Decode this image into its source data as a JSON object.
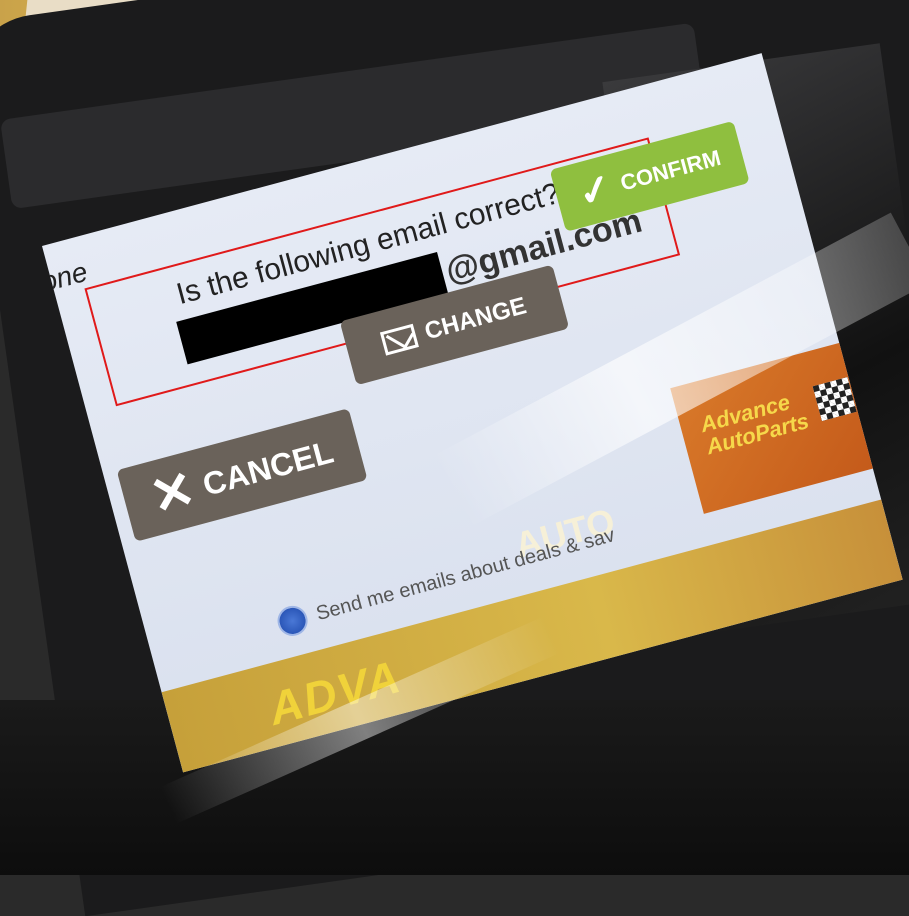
{
  "screen": {
    "brand_fragment": "one",
    "question": "Is the following email correct?",
    "email_domain": "@gmail.com",
    "buttons": {
      "confirm": "CONFIRM",
      "change": "CHANGE",
      "cancel": "CANCEL"
    },
    "optin_label": "Send me emails about deals & sav",
    "footer_text": "ADVA",
    "footer_auto": "AUTO",
    "logo_text_line1": "Advance",
    "logo_text_line2": "AutoParts"
  },
  "colors": {
    "confirm_green": "#8fbf3f",
    "button_gray": "#6a625a",
    "highlight_red": "#e01a1a",
    "radio_blue": "#2b57b8"
  }
}
